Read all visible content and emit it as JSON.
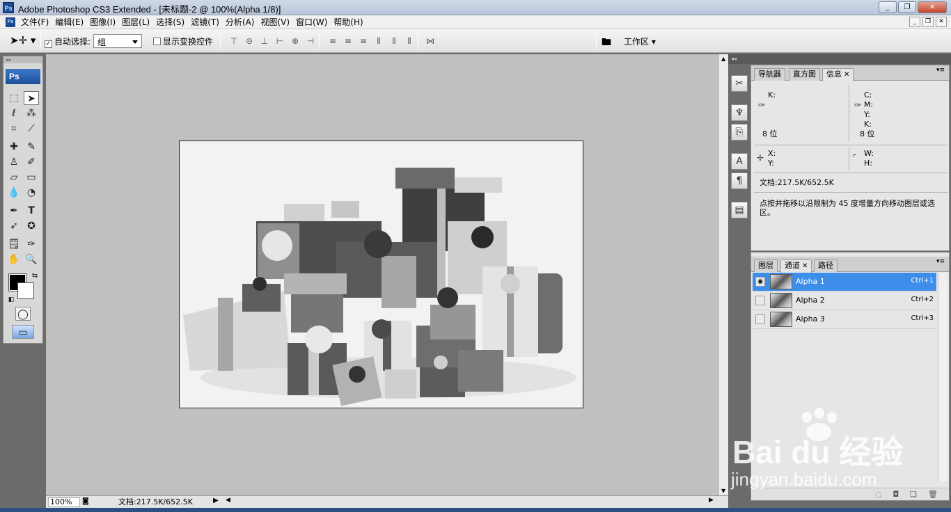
{
  "window": {
    "title": "Adobe Photoshop CS3 Extended - [未标题-2 @ 100%(Alpha 1/8)]",
    "logo": "Ps",
    "controls": [
      "_",
      "❐",
      "✕"
    ]
  },
  "menu": {
    "logo": "Ps",
    "items": [
      "文件(F)",
      "编辑(E)",
      "图像(I)",
      "图层(L)",
      "选择(S)",
      "滤镜(T)",
      "分析(A)",
      "视图(V)",
      "窗口(W)",
      "帮助(H)"
    ],
    "mdi_controls": [
      "_",
      "❐",
      "✕"
    ]
  },
  "options": {
    "auto_select_label": "自动选择:",
    "auto_select_value": "组",
    "show_transform_label": "显示变换控件",
    "workspace_label": "工作区 ▾"
  },
  "toolbox": {
    "logo": "Ps"
  },
  "document": {
    "alt": "礼物盒灰度图"
  },
  "status": {
    "zoom": "100%",
    "doc_info": "文档:217.5K/652.5K"
  },
  "info_panel": {
    "tabs": [
      "导航器",
      "直方图",
      "信息"
    ],
    "k_left": "K:",
    "c_label": "C:",
    "m_label": "M:",
    "y_label": "Y:",
    "k_right": "K:",
    "bits_left": "8 位",
    "bits_right": "8 位",
    "x_label": "X:",
    "y2_label": "Y:",
    "w_label": "W:",
    "h_label": "H:",
    "doc_info": "文档:217.5K/652.5K",
    "hint": "点按并拖移以沿限制为 45 度增量方向移动图层或选区。"
  },
  "channels_panel": {
    "tabs": [
      "图层",
      "通道",
      "路径"
    ],
    "channels": [
      {
        "name": "Alpha 1",
        "shortcut": "Ctrl+1"
      },
      {
        "name": "Alpha 2",
        "shortcut": "Ctrl+2"
      },
      {
        "name": "Alpha 3",
        "shortcut": "Ctrl+3"
      }
    ]
  },
  "watermark": {
    "brand": "Bai du 经验",
    "url": "jingyan.baidu.com"
  }
}
